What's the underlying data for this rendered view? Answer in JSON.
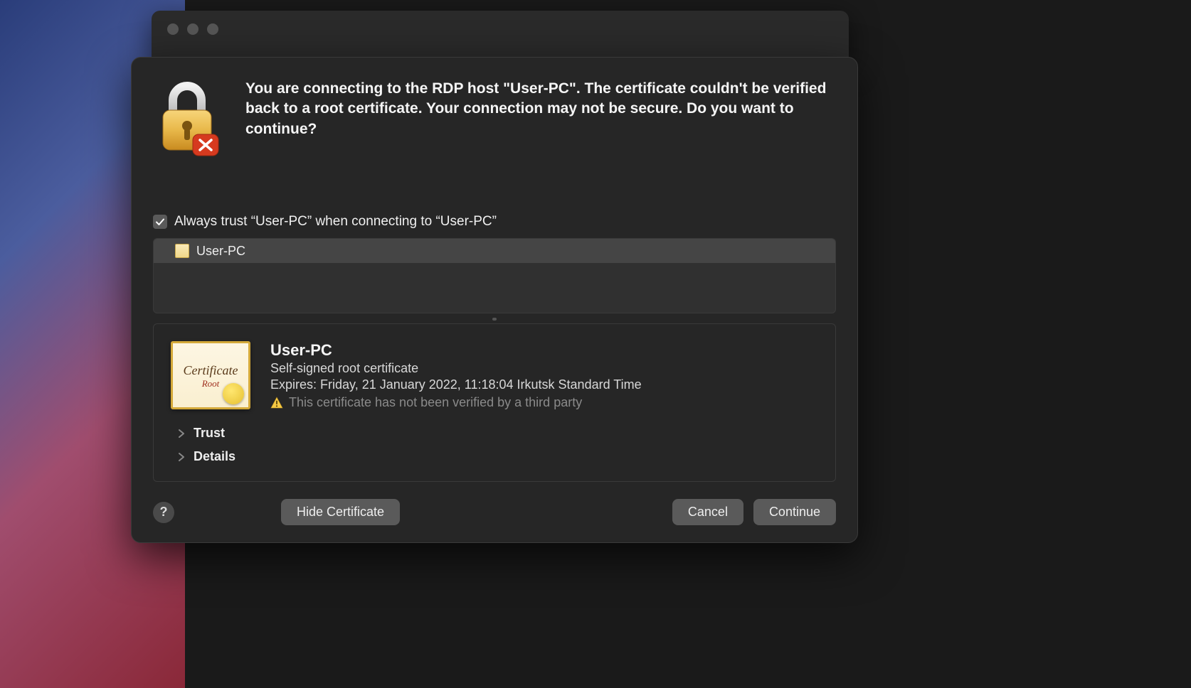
{
  "dialog": {
    "message": "You are connecting to the RDP host \"User-PC\". The certificate couldn't be verified back to a root certificate. Your connection may not be secure. Do you want to continue?",
    "always_trust_label": "Always trust “User-PC” when connecting to “User-PC”",
    "always_trust_checked": true,
    "cert_list": [
      {
        "name": "User-PC"
      }
    ],
    "certificate": {
      "name": "User-PC",
      "type": "Self-signed root certificate",
      "expires": "Expires: Friday, 21 January 2022, 11:18:04 Irkutsk Standard Time",
      "warning": "This certificate has not been verified by a third party"
    },
    "disclosures": {
      "trust": "Trust",
      "details": "Details"
    },
    "buttons": {
      "help": "?",
      "hide_certificate": "Hide Certificate",
      "cancel": "Cancel",
      "continue": "Continue"
    }
  }
}
